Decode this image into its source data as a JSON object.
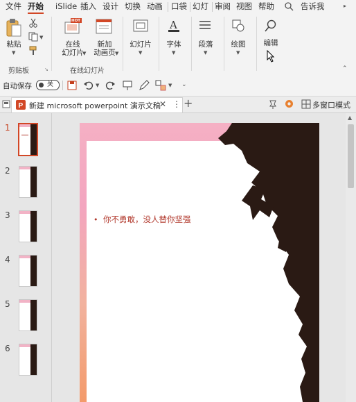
{
  "menu": {
    "tabs": [
      "文件",
      "开始",
      "iSlide",
      "插入",
      "设计",
      "切换",
      "动画",
      "口袋",
      "幻灯",
      "审阅",
      "视图",
      "帮助"
    ],
    "tell_me": "告诉我"
  },
  "ribbon": {
    "paste_label": "粘贴",
    "clipboard_group": "剪贴板",
    "online_slides_label": "在线\n幻灯片",
    "hot_badge": "HOT",
    "new_anim_label": "新加\n动画页",
    "online_group": "在线幻灯片",
    "slides_label": "幻灯片",
    "font_label": "字体",
    "paragraph_label": "段落",
    "drawing_label": "绘图",
    "editing_label": "编辑"
  },
  "qat": {
    "autosave_label": "自动保存",
    "toggle_state": "关"
  },
  "tabbar": {
    "doc_title": "新建 microsoft powerpoint 演示文稿",
    "multiwindow_label": "多窗口模式"
  },
  "thumbnails": [
    {
      "num": "1",
      "selected": true
    },
    {
      "num": "2",
      "selected": false
    },
    {
      "num": "3",
      "selected": false
    },
    {
      "num": "4",
      "selected": false
    },
    {
      "num": "5",
      "selected": false
    },
    {
      "num": "6",
      "selected": false
    }
  ],
  "slide": {
    "bullet": "•",
    "text": "你不勇敢，没人替你坚强"
  },
  "colors": {
    "accent": "#d24726",
    "slide_text": "#b23a2e"
  }
}
